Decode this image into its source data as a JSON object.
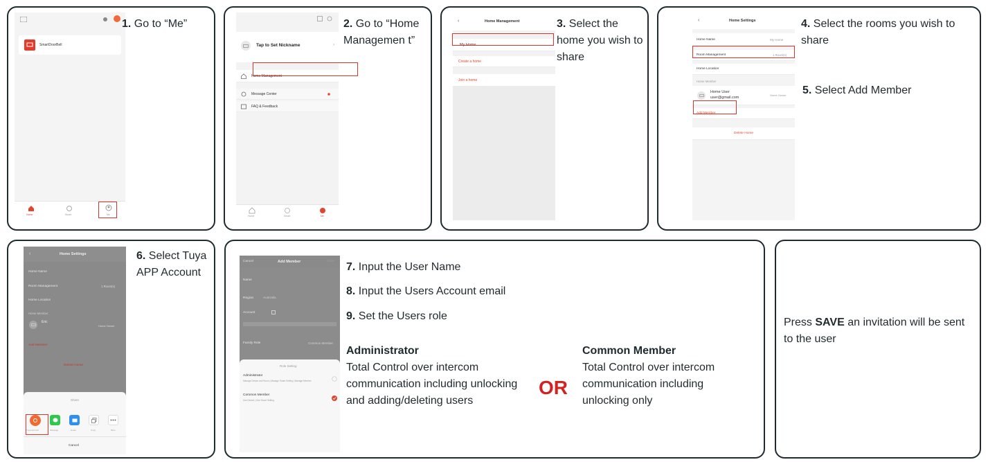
{
  "panel1": {
    "step_num": "1.",
    "step_text": "Go to “Me”",
    "device_name": "SmartDoorBell",
    "tabs": [
      "Home",
      "Smart",
      "Me"
    ]
  },
  "panel2": {
    "step_num": "2.",
    "step_text": "Go to “Home Managemen t”",
    "nickname": "Tap to Set Nickname",
    "items": [
      "Home Management",
      "Message Center",
      "FAQ & Feedback"
    ],
    "tabs": [
      "Home",
      "Smart",
      "Me"
    ]
  },
  "panel3": {
    "step_num": "3.",
    "step_text": "Select the home you wish to share",
    "title": "Home Management",
    "items": [
      "My Home",
      "Create a home",
      "Join a home"
    ]
  },
  "panel4": {
    "step4_num": "4.",
    "step4_text": "Select the rooms you wish to share",
    "step5_num": "5.",
    "step5_text": "Select Add Member",
    "title": "Home Settings",
    "home_name_label": "Home Name",
    "home_name_value": "My Home",
    "room_mgmt_label": "Room Management",
    "room_mgmt_value": "1 Room(s)",
    "home_location_label": "Home Location",
    "home_member_label": "Home Member",
    "member_name": "Home User",
    "member_email": "user@gmail.com",
    "member_role": "Home Owner",
    "add_member": "Add Member",
    "delete_home": "Delete Home"
  },
  "panel5": {
    "step_num": "6.",
    "step_text": "Select Tuya APP Account",
    "title": "Home Settings",
    "home_name_label": "Home Name",
    "room_mgmt_label": "Room Management",
    "room_mgmt_value": "1 Room(s)",
    "home_location_label": "Home Location",
    "home_member_label": "Home Member",
    "member_name": "Eric",
    "member_role": "Home Owner",
    "add_member": "Add Member",
    "delete_home": "Delete Home",
    "share_title": "Share",
    "share_items": [
      "Tuya account",
      "Message",
      "Email",
      "Copy",
      "More"
    ],
    "cancel": "Cancel"
  },
  "panel6": {
    "step7_num": "7.",
    "step7_text": "Input the User Name",
    "step8_num": "8.",
    "step8_text": "Input the Users Account email",
    "step9_num": "9.",
    "step9_text": "Set the Users role",
    "admin_title": "Administrator",
    "admin_desc": "Total Control over intercom communication including unlocking and adding/deleting users",
    "or_text": "OR",
    "common_title": "Common Member",
    "common_desc": "Total Control over intercom communication including unlocking only",
    "phone_cancel": "Cancel",
    "phone_title": "Add Member",
    "phone_save": "Save",
    "name_label": "Name",
    "region_label": "Region",
    "region_value": "Australia",
    "account_label": "Account",
    "family_role_label": "Family Role",
    "family_role_value": "Common Member",
    "role_setting": "Role Setting",
    "admin_option": "Administrator",
    "admin_option_desc": "Manage Device and Room | Manage Smart Setting | Manage Member",
    "common_option": "Common Member",
    "common_option_desc": "Use Device | Use Smart Setting"
  },
  "panel7": {
    "text_pre": "Press",
    "text_bold": "SAVE",
    "text_post": "an invitation will be sent to the user"
  }
}
